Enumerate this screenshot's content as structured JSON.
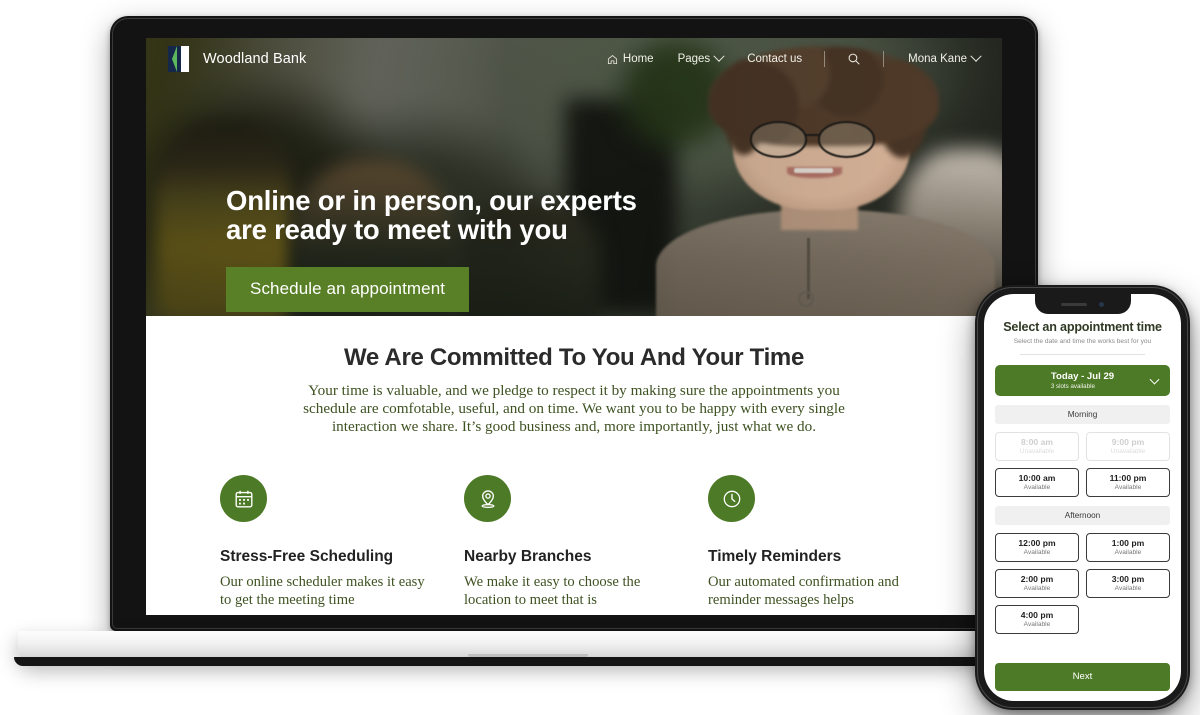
{
  "site": {
    "brand": "Woodland Bank",
    "logo_icon": "woodland-bank-logo",
    "nav": {
      "home": "Home",
      "home_icon": "home-icon",
      "pages": "Pages",
      "pages_caret_icon": "chevron-down-icon",
      "contact": "Contact us",
      "search_icon": "search-icon",
      "user": "Mona Kane",
      "user_caret_icon": "chevron-down-icon"
    },
    "hero": {
      "heading_line1": "Online or in person, our experts",
      "heading_line2": "are ready to meet with you",
      "cta": "Schedule an appointment"
    },
    "committed": {
      "title": "We Are Committed To You And Your Time",
      "body": "Your time is valuable, and we pledge to respect it by making sure the appointments you schedule are comfotable, useful, and on time. We want you to be happy with every single interaction we share. It’s good business and, more importantly, just what we do."
    },
    "cards": [
      {
        "icon": "calendar-icon",
        "title": "Stress-Free Scheduling",
        "text": "Our online scheduler makes it easy to get the meeting time"
      },
      {
        "icon": "map-pin-icon",
        "title": "Nearby Branches",
        "text": "We make it easy to choose the location to meet that is"
      },
      {
        "icon": "clock-icon",
        "title": "Timely Reminders",
        "text": "Our automated confirmation and reminder messages helps"
      }
    ]
  },
  "phone": {
    "title": "Select an appointment time",
    "subtitle": "Select the date and time the works best for you",
    "day_selector": {
      "label": "Today - Jul 29",
      "sublabel": "3 slots available",
      "caret_icon": "chevron-down-icon"
    },
    "groups": [
      {
        "name": "Morning",
        "slots": [
          {
            "time": "8:00 am",
            "status": "Unavailable",
            "available": false
          },
          {
            "time": "9:00 pm",
            "status": "Unavailable",
            "available": false
          },
          {
            "time": "10:00 am",
            "status": "Available",
            "available": true
          },
          {
            "time": "11:00 pm",
            "status": "Available",
            "available": true
          }
        ]
      },
      {
        "name": "Afternoon",
        "slots": [
          {
            "time": "12:00 pm",
            "status": "Available",
            "available": true
          },
          {
            "time": "1:00 pm",
            "status": "Available",
            "available": true
          },
          {
            "time": "2:00 pm",
            "status": "Available",
            "available": true
          },
          {
            "time": "3:00 pm",
            "status": "Available",
            "available": true
          },
          {
            "time": "4:00 pm",
            "status": "Available",
            "available": true
          }
        ]
      }
    ],
    "next": "Next"
  },
  "colors": {
    "brand_green": "#4d7a26",
    "cta_green": "#5a8027",
    "body_green": "#3e5222",
    "heading_dark": "#2b2b2b"
  }
}
